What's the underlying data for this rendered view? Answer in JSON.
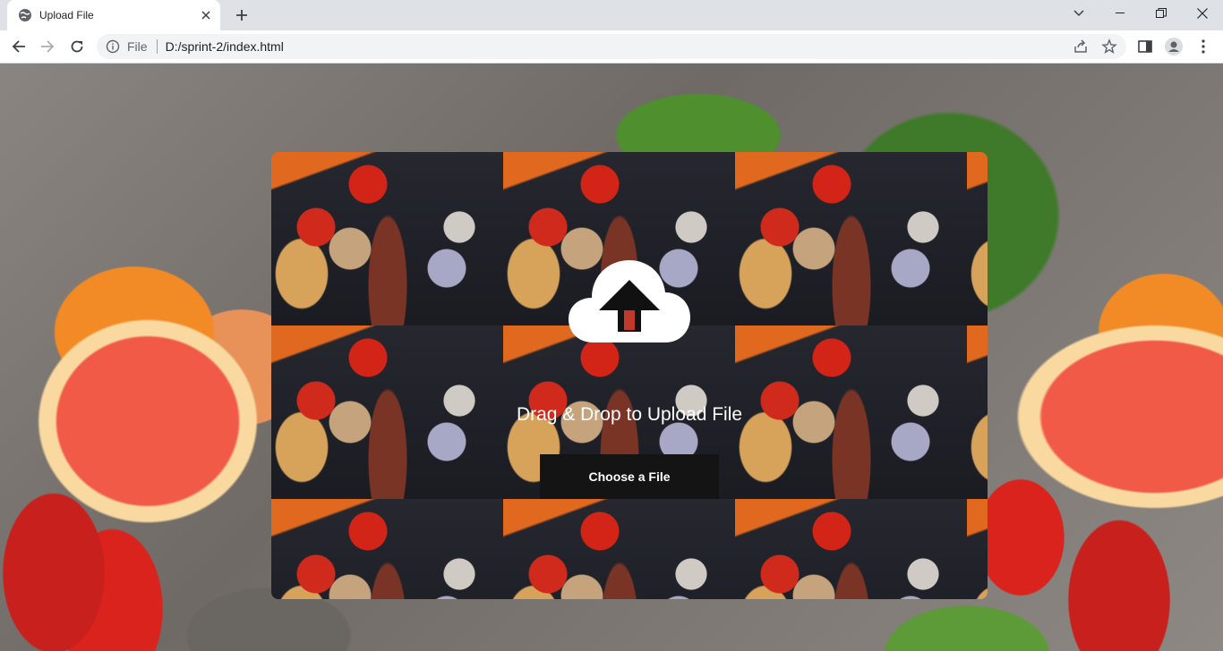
{
  "browser": {
    "tab": {
      "title": "Upload File",
      "favicon": "globe-icon"
    },
    "address": {
      "scheme_label": "File",
      "url": "D:/sprint-2/index.html"
    }
  },
  "upload": {
    "icon": "cloud-upload-icon",
    "heading": "Drag & Drop to Upload File",
    "button_label": "Choose a File"
  },
  "colors": {
    "button_bg": "#141414",
    "text": "#ffffff",
    "chrome_frame": "#dee1e6"
  }
}
